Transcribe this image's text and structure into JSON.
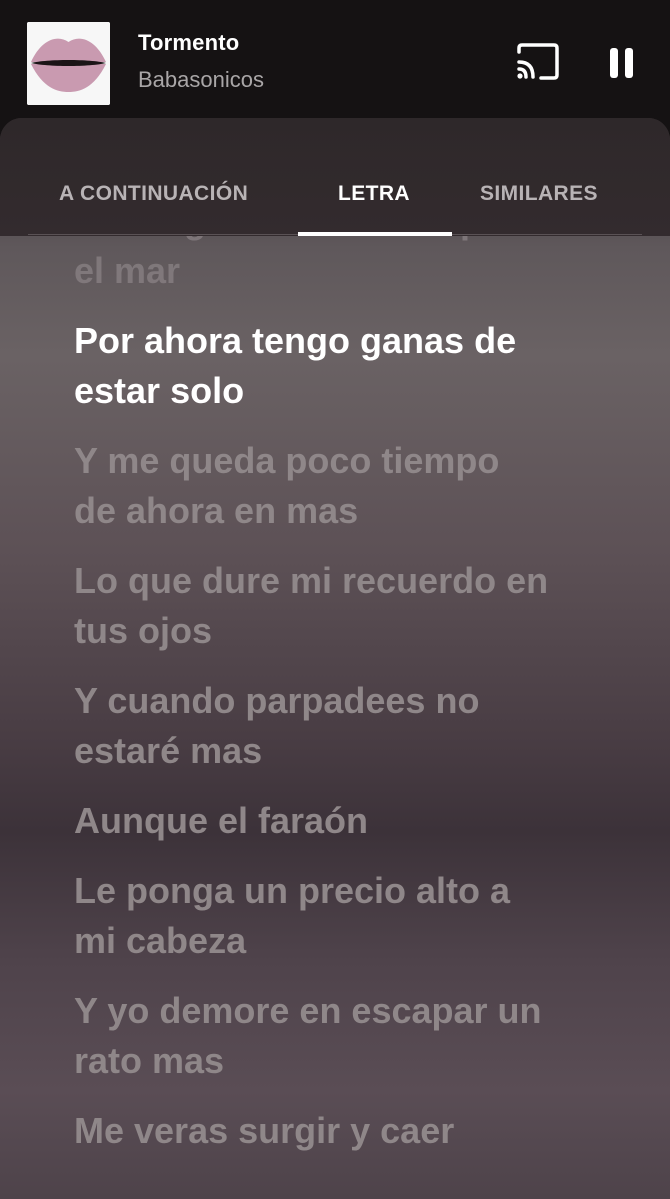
{
  "player": {
    "title": "Tormento",
    "artist": "Babasonicos",
    "cast_icon": "cast-icon",
    "pause_icon": "pause-icon",
    "album_art": "lips-album-art"
  },
  "tabs": [
    {
      "label": "A CONTINUACIÓN",
      "active": false
    },
    {
      "label": "LETRA",
      "active": true
    },
    {
      "label": "SIMILARES",
      "active": false
    }
  ],
  "lyrics": {
    "lines": [
      {
        "text": "naufragio zozobrando por\nel mar",
        "state": "past"
      },
      {
        "text": "Por ahora tengo ganas de\nestar solo",
        "state": "active"
      },
      {
        "text": "Y me queda poco tiempo\nde ahora en mas",
        "state": "upcoming"
      },
      {
        "text": "Lo que dure mi recuerdo en\ntus ojos",
        "state": "upcoming"
      },
      {
        "text": "Y cuando parpadees no\nestaré mas",
        "state": "upcoming"
      },
      {
        "text": "Aunque el faraón",
        "state": "upcoming"
      },
      {
        "text": "Le ponga un precio alto a\nmi cabeza",
        "state": "upcoming"
      },
      {
        "text": "Y yo demore en escapar un\nrato mas",
        "state": "upcoming"
      },
      {
        "text": "Me veras surgir y caer",
        "state": "upcoming"
      }
    ]
  },
  "colors": {
    "header_bg": "#151213",
    "active_lyric": "#ffffff",
    "inactive_lyric": "#8f8789",
    "album_lips": "#c99ab0"
  }
}
